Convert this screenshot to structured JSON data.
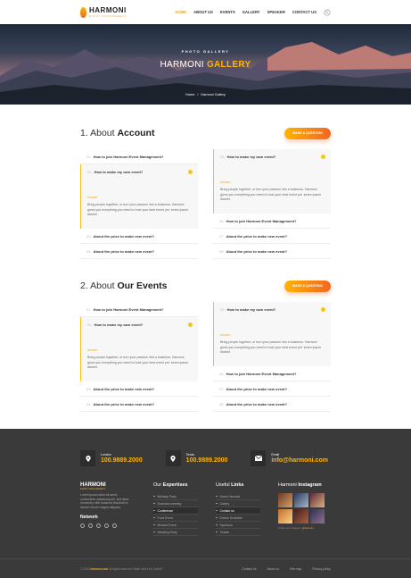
{
  "header": {
    "logo_name": "HARMONI",
    "logo_sub": "EVENT MANAGEMENT",
    "nav": [
      "HOME",
      "ABOUT US",
      "EVENTS",
      "GALLERY",
      "SPEAKER",
      "CONTACT US"
    ],
    "active_nav": "HOME"
  },
  "hero": {
    "kicker": "PHOTO GALLERY",
    "title_plain": "HARMONI",
    "title_accent": "GALLERY",
    "breadcrumb_home": "Home",
    "breadcrumb_sep": "/",
    "breadcrumb_current": "Harmoni Gallery"
  },
  "sections": [
    {
      "title_prefix": "1. About",
      "title_bold": "Account",
      "button": "MAKE A QUESTION",
      "left": [
        {
          "num": "01.",
          "q": "How to join Harmoni Event Management?"
        },
        {
          "num": "02.",
          "q": "How to make my own event?",
          "open": true
        },
        {
          "num": "03.",
          "q": "About the price to make new event?"
        },
        {
          "num": "04.",
          "q": "About the price to make new event?"
        }
      ],
      "right": [
        {
          "num": "05.",
          "q": "How to make my own event?",
          "open": true
        },
        {
          "num": "06.",
          "q": "How to join Harmoni Event Management?"
        },
        {
          "num": "07.",
          "q": "About the price to make new event?"
        },
        {
          "num": "08.",
          "q": "About the price to make new event?"
        }
      ]
    },
    {
      "title_prefix": "2. About",
      "title_bold": "Our Events",
      "button": "MAKE A QUESTION",
      "left": [
        {
          "num": "01.",
          "q": "How to join Harmoni Event Management?"
        },
        {
          "num": "02.",
          "q": "How to make my own event?",
          "open": true
        },
        {
          "num": "03.",
          "q": "About the price to make new event?"
        },
        {
          "num": "04.",
          "q": "About the price to make new event?"
        }
      ],
      "right": [
        {
          "num": "05.",
          "q": "How to make my own event?",
          "open": true
        },
        {
          "num": "06.",
          "q": "How to join Harmoni Event Management?"
        },
        {
          "num": "07.",
          "q": "About the price to make new event?"
        },
        {
          "num": "08.",
          "q": "About the price to make new event?"
        }
      ]
    }
  ],
  "answer": {
    "label": "Answer:",
    "text": "Bring people together, or turn your passion into a business. Harmoni gives you everything you need to host your best event yet. lorem ipsum diamet."
  },
  "footer": {
    "contacts": [
      {
        "icon": "map-pin-icon",
        "label": "London",
        "value": "100.9889.2000"
      },
      {
        "icon": "map-pin-icon",
        "label": "Texas",
        "value": "100.9889.2000"
      },
      {
        "icon": "mail-icon",
        "label": "Email",
        "value": "info@harmoni.com"
      }
    ],
    "logo_name": "HARMONI",
    "logo_sub": "EVENT MANAGEMENT",
    "about": "Lorem ipsum dolor sit amet, consectetur adipiscing elit, sed diam nonummy nibh euismod tincidunt ut laoreet dolore magna aliquam.",
    "network": "Network",
    "expertise_prefix": "Our",
    "expertise_bold": "Expertises",
    "expertise": [
      "Birthday Party",
      "Business meeting",
      "Conference",
      "Food Event",
      "Musical Event",
      "Wedding Party"
    ],
    "expertise_highlight": 2,
    "links_prefix": "Useful",
    "links_bold": "Links",
    "links": [
      "About Harmoni",
      "Gallery",
      "Contact us",
      "Events Schedule",
      "Sponsors",
      "Tickets"
    ],
    "links_highlight": 2,
    "insta_prefix": "Harmoni",
    "insta_bold": "Instagram",
    "insta_note_prefix": "Follow our instagram",
    "insta_note_handle": "@harmoni",
    "copyright_prefix": "© 2018",
    "copyright_brand": "harmoni.com",
    "copyright_suffix": "All rights reserved. Made with",
    "copyright_end": "by SonNH",
    "bottom_links": [
      "Contact us",
      "About us",
      "Site map",
      "Privacy policy"
    ]
  }
}
